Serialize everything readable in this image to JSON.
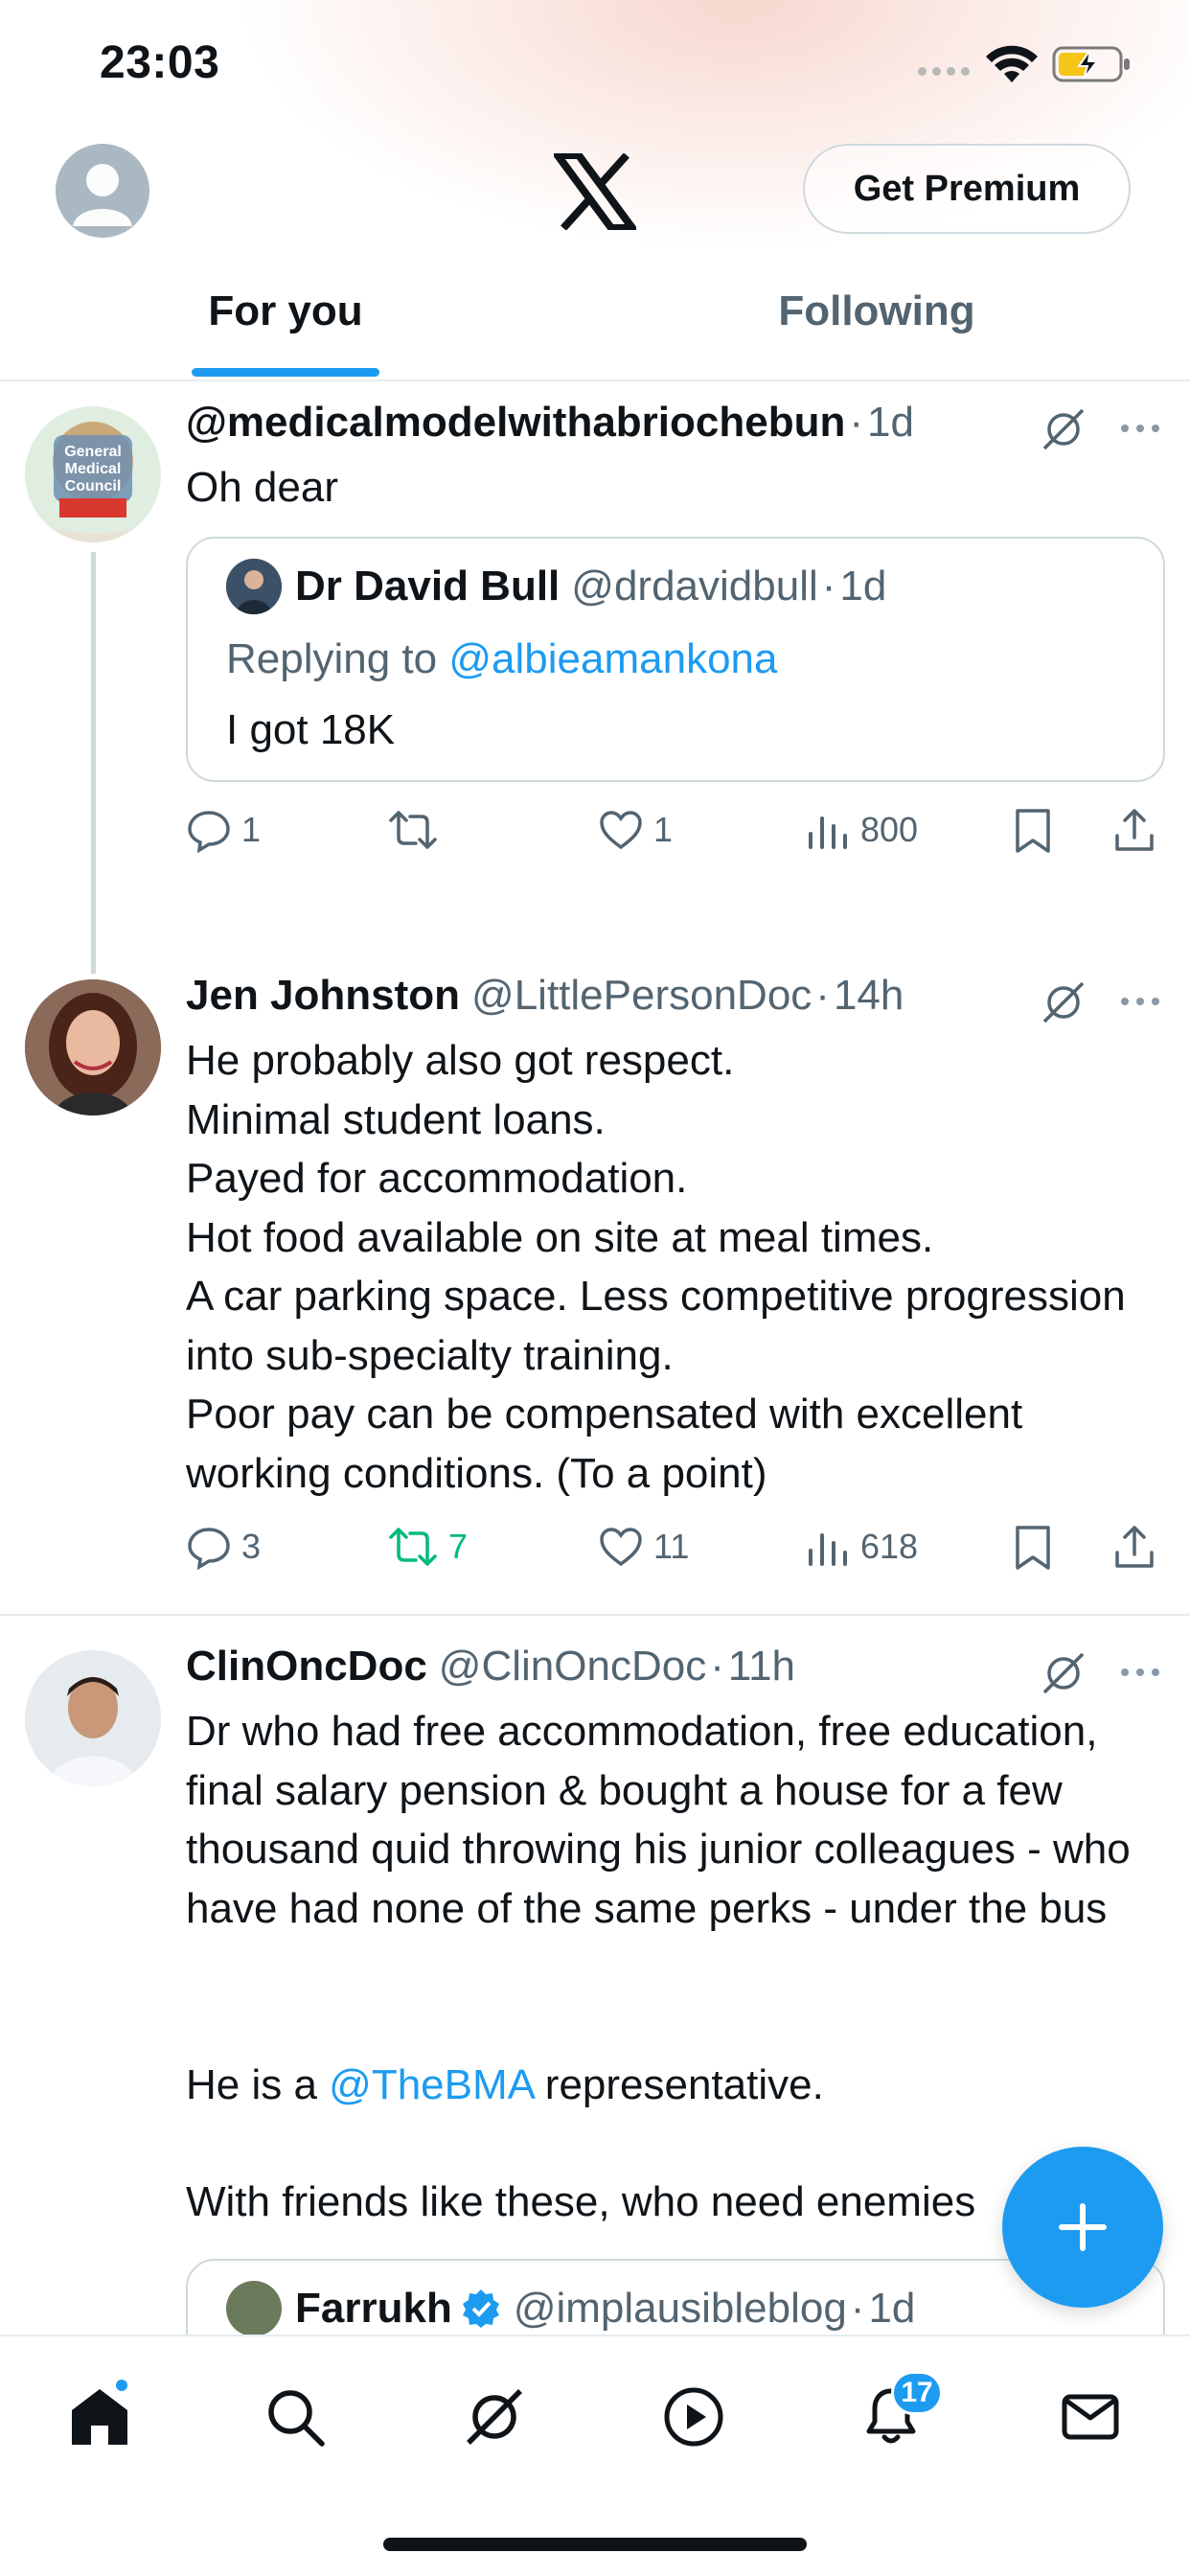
{
  "status_bar": {
    "time": "23:03"
  },
  "header": {
    "premium_label": "Get Premium"
  },
  "tabs": [
    {
      "label": "For you",
      "active": true
    },
    {
      "label": "Following",
      "active": false
    }
  ],
  "tweets": [
    {
      "name": "@medicalmodelwithabriochebun",
      "handle": "",
      "time": "1d",
      "text": "Oh dear",
      "avatar_text": "General Medical Council",
      "quote": {
        "name": "Dr David Bull",
        "handle": "@drdavidbull",
        "time": "1d",
        "replying_prefix": "Replying to",
        "replying_to": "@albieamankona",
        "text": "I got 18K"
      },
      "replies": "1",
      "retweets": "",
      "likes": "1",
      "views": "800"
    },
    {
      "name": "Jen Johnston",
      "handle": "@LittlePersonDoc",
      "time": "14h",
      "text": "He probably also got respect.\nMinimal student loans.\nPayed for accommodation.\nHot food available on site at meal times.\nA car parking space. Less competitive progression into sub-specialty training.\nPoor pay can be compensated with excellent working conditions. (To a point)",
      "replies": "3",
      "retweets": "7",
      "likes": "11",
      "views": "618"
    },
    {
      "name": "ClinOncDoc",
      "handle": "@ClinOncDoc",
      "time": "11h",
      "text_part1": "Dr who had free accommodation, free education, final salary pension & bought a house for a few thousand quid throwing his junior colleagues - who have had none of the same perks - under the bus",
      "text_part2_prefix": "He is a ",
      "text_part2_link": "@TheBMA",
      "text_part2_suffix": " representative.",
      "text_part3": "With friends like these, who need enemies",
      "quote": {
        "name": "Farrukh",
        "handle": "@implausibleblog",
        "time": "1d"
      }
    }
  ],
  "bottom_nav": {
    "notifications_badge": "17"
  },
  "colors": {
    "accent": "#1d9bf0",
    "retweet_active": "#00ba7c",
    "secondary_text": "#536471"
  }
}
